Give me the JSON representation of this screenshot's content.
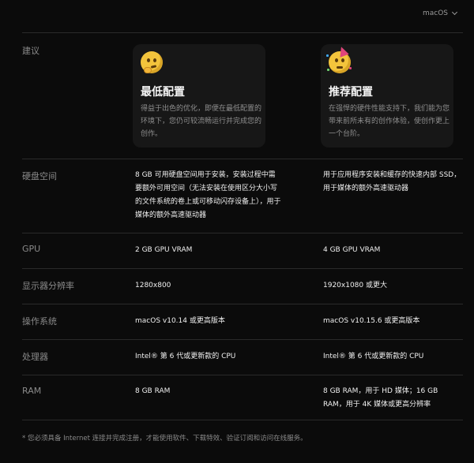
{
  "os_selector": {
    "value": "macOS"
  },
  "rows": {
    "recommendation": {
      "label": "建议",
      "min": {
        "title": "最低配置",
        "desc": "得益于出色的优化，即便在最低配置的环境下，您仍可较流畅运行并完成您的创作。"
      },
      "rec": {
        "title": "推荐配置",
        "desc": "在强悍的硬件性能支持下，我们能为您带来前所未有的创作体验，使创作更上一个台阶。"
      }
    },
    "disk": {
      "label": "硬盘空间",
      "min": "8 GB 可用硬盘空间用于安装，安装过程中需要额外可用空间（无法安装在使用区分大小写的文件系统的卷上或可移动闪存设备上），用于媒体的额外高速驱动器",
      "rec": "用于应用程序安装和缓存的快速内部 SSD，用于媒体的额外高速驱动器"
    },
    "gpu": {
      "label": "GPU",
      "min": "2 GB GPU VRAM",
      "rec": "4 GB GPU VRAM"
    },
    "display": {
      "label": "显示器分辨率",
      "min": "1280x800",
      "rec": "1920x1080 或更大"
    },
    "os": {
      "label": "操作系统",
      "min": "macOS v10.14 或更高版本",
      "rec": "macOS v10.15.6 或更高版本"
    },
    "cpu": {
      "label": "处理器",
      "min": "Intel® 第 6 代或更新款的 CPU",
      "rec": "Intel® 第 6 代或更新款的 CPU"
    },
    "ram": {
      "label": "RAM",
      "min": "8 GB RAM",
      "rec": "8 GB RAM，用于 HD 媒体；16 GB RAM，用于 4K 媒体或更高分辨率"
    }
  },
  "footnote": "* 您必须具备 Internet 连接并完成注册，才能使用软件、下载特效、验证订阅和访问在线服务。",
  "icons": {
    "min": "thinking-face-icon",
    "rec": "party-face-icon"
  },
  "colors": {
    "background": "#0b0b0b",
    "card": "#171717",
    "divider": "#2a2a2a",
    "label": "#8a8a8a",
    "text": "#f0f0f0"
  }
}
